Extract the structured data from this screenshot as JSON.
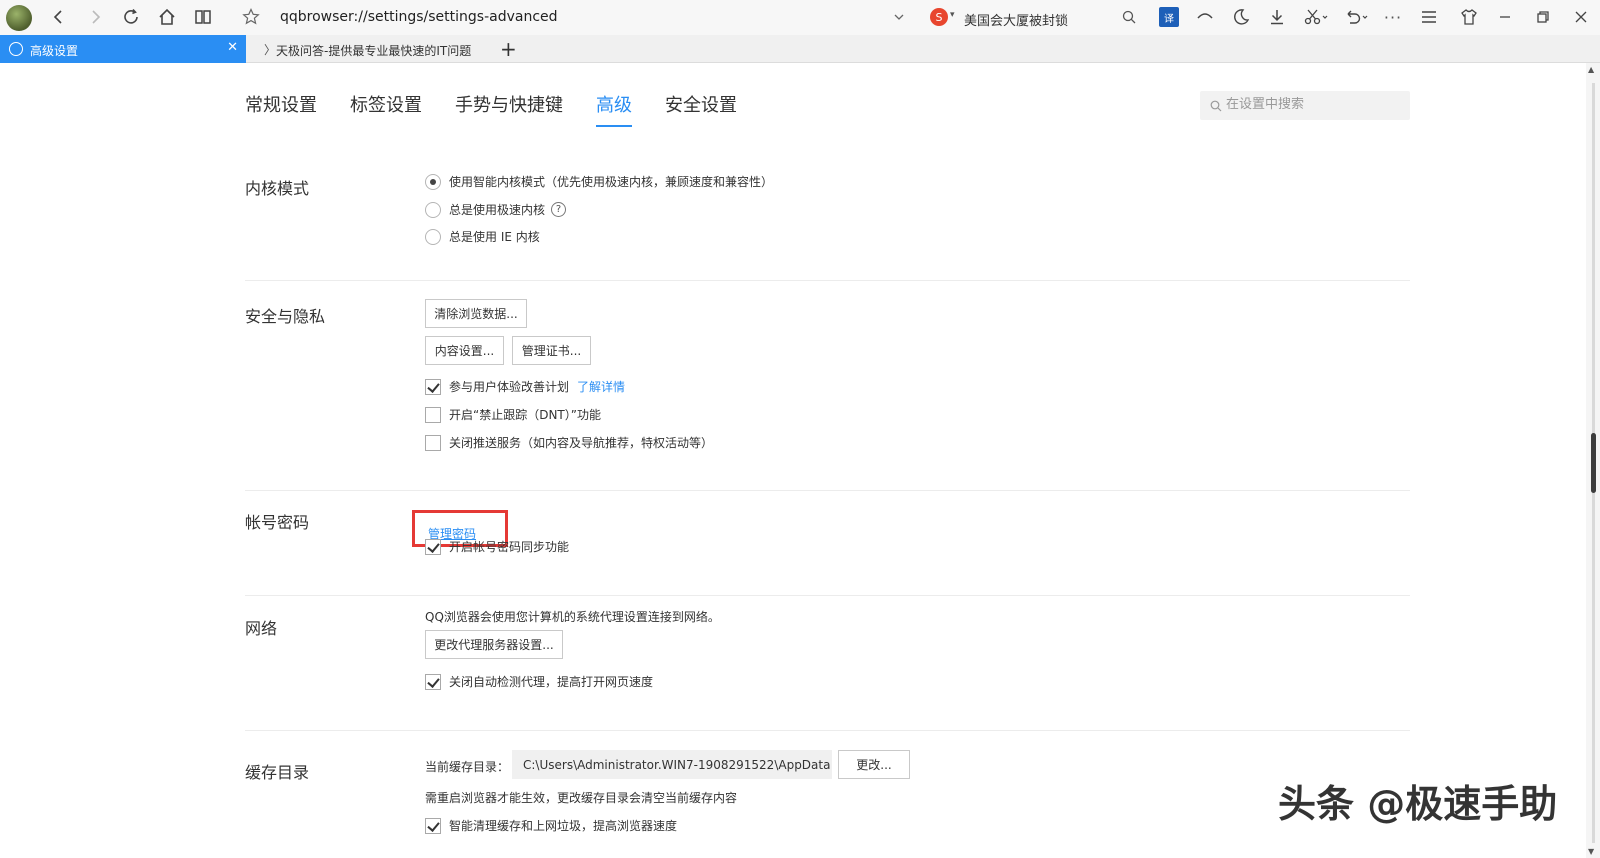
{
  "toolbar": {
    "url": "qqbrowser://settings/settings-advanced",
    "search_query": "美国会大厦被封锁",
    "icons": [
      "back-icon",
      "forward-icon",
      "refresh-icon",
      "home-icon",
      "reader-icon",
      "star-icon",
      "dropdown-icon",
      "search-engine-icon",
      "search-icon",
      "translate-icon",
      "mouse-gesture-icon",
      "night-mode-icon",
      "download-icon",
      "screenshot-icon",
      "undo-icon",
      "more-icon",
      "menu-icon",
      "shirt-icon",
      "minimize-icon",
      "restore-icon",
      "close-icon"
    ]
  },
  "tabs": {
    "active": {
      "title": "高级设置"
    },
    "inactive": {
      "title": "天极问答-提供最专业最快速的IT问题"
    }
  },
  "nav": {
    "items": [
      {
        "label": "常规设置"
      },
      {
        "label": "标签设置"
      },
      {
        "label": "手势与快捷键"
      },
      {
        "label": "高级",
        "active": true
      },
      {
        "label": "安全设置"
      }
    ],
    "search_placeholder": "在设置中搜索"
  },
  "kernel": {
    "title": "内核模式",
    "options": [
      {
        "label": "使用智能内核模式（优先使用极速内核，兼顾速度和兼容性）",
        "selected": true
      },
      {
        "label": "总是使用极速内核",
        "selected": false
      },
      {
        "label": "总是使用 IE 内核",
        "selected": false
      }
    ]
  },
  "privacy": {
    "title": "安全与隐私",
    "clear_button": "清除浏览数据...",
    "content_button": "内容设置...",
    "cert_button": "管理证书...",
    "options": [
      {
        "label": "参与用户体验改善计划",
        "checked": true,
        "link": "了解详情"
      },
      {
        "label": "开启“禁止跟踪（DNT）”功能",
        "checked": false
      },
      {
        "label": "关闭推送服务（如内容及导航推荐，特权活动等）",
        "checked": false
      }
    ]
  },
  "account": {
    "title": "帐号密码",
    "manage_link": "管理密码",
    "sync_label": "开启帐号密码同步功能",
    "sync_checked": true
  },
  "network": {
    "title": "网络",
    "note": "QQ浏览器会使用您计算机的系统代理设置连接到网络。",
    "proxy_button": "更改代理服务器设置...",
    "auto_detect_label": "关闭自动检测代理，提高打开网页速度",
    "auto_detect_checked": true
  },
  "cache": {
    "title": "缓存目录",
    "current_label": "当前缓存目录：",
    "path": "C:\\Users\\Administrator.WIN7-1908291522\\AppData",
    "change_button": "更改...",
    "note": "需重启浏览器才能生效，更改缓存目录会清空当前缓存内容",
    "smart_clean_label": "智能清理缓存和上网垃圾，提高浏览器速度",
    "smart_clean_checked": true
  },
  "watermark": "头条 @极速手助"
}
